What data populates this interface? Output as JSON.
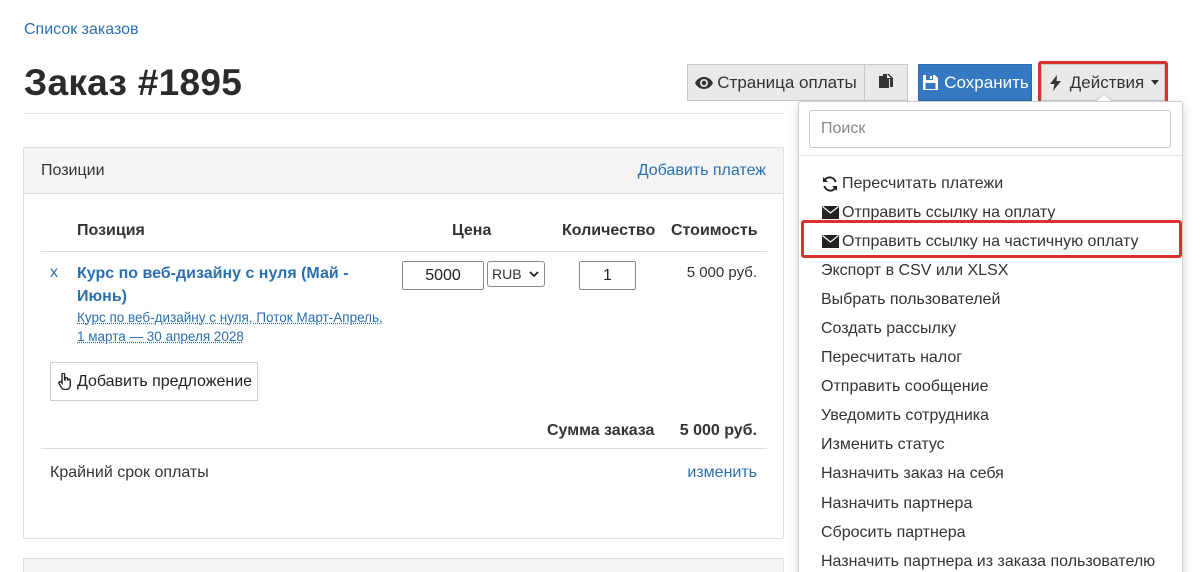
{
  "breadcrumb": "Список заказов",
  "page_title": "Заказ #1895",
  "toolbar": {
    "pay_page_label": "Страница оплаты",
    "save_label": "Сохранить",
    "actions_label": "Действия"
  },
  "panel": {
    "title": "Позиции",
    "add_payment": "Добавить платеж",
    "columns": [
      "Позиция",
      "Цена",
      "Количество",
      "Стоимость"
    ],
    "item": {
      "remove": "x",
      "title": "Курс по веб-дизайну с нуля (Май - Июнь)",
      "subtitle": "Курс по веб-дизайну с нуля, Поток Март-Апрель, 1 марта — 30 апреля 2028",
      "price": "5000",
      "currency": "RUB",
      "quantity": "1",
      "cost": "5 000 руб."
    },
    "add_offer": "Добавить предложение",
    "sum_label": "Сумма заказа",
    "sum_value": "5 000 руб.",
    "deadline_label": "Крайний срок оплаты",
    "deadline_edit": "изменить"
  },
  "dropdown": {
    "search_placeholder": "Поиск",
    "items": [
      {
        "label": "Пересчитать платежи",
        "icon": "refresh-icon"
      },
      {
        "label": "Отправить ссылку на оплату",
        "icon": "envelope-icon"
      },
      {
        "label": "Отправить ссылку на частичную оплату",
        "icon": "envelope-icon"
      },
      {
        "label": "Экспорт в CSV или XLSX"
      },
      {
        "label": "Выбрать пользователей"
      },
      {
        "label": "Создать рассылку"
      },
      {
        "label": "Пересчитать налог"
      },
      {
        "label": "Отправить сообщение"
      },
      {
        "label": "Уведомить сотрудника"
      },
      {
        "label": "Изменить статус"
      },
      {
        "label": "Назначить заказ на себя"
      },
      {
        "label": "Назначить партнера"
      },
      {
        "label": "Сбросить партнера"
      },
      {
        "label": "Назначить партнера из заказа пользователю"
      }
    ]
  },
  "colors": {
    "link": "#2a6fb0",
    "primary": "#3479c2",
    "highlight": "#d9322e"
  }
}
